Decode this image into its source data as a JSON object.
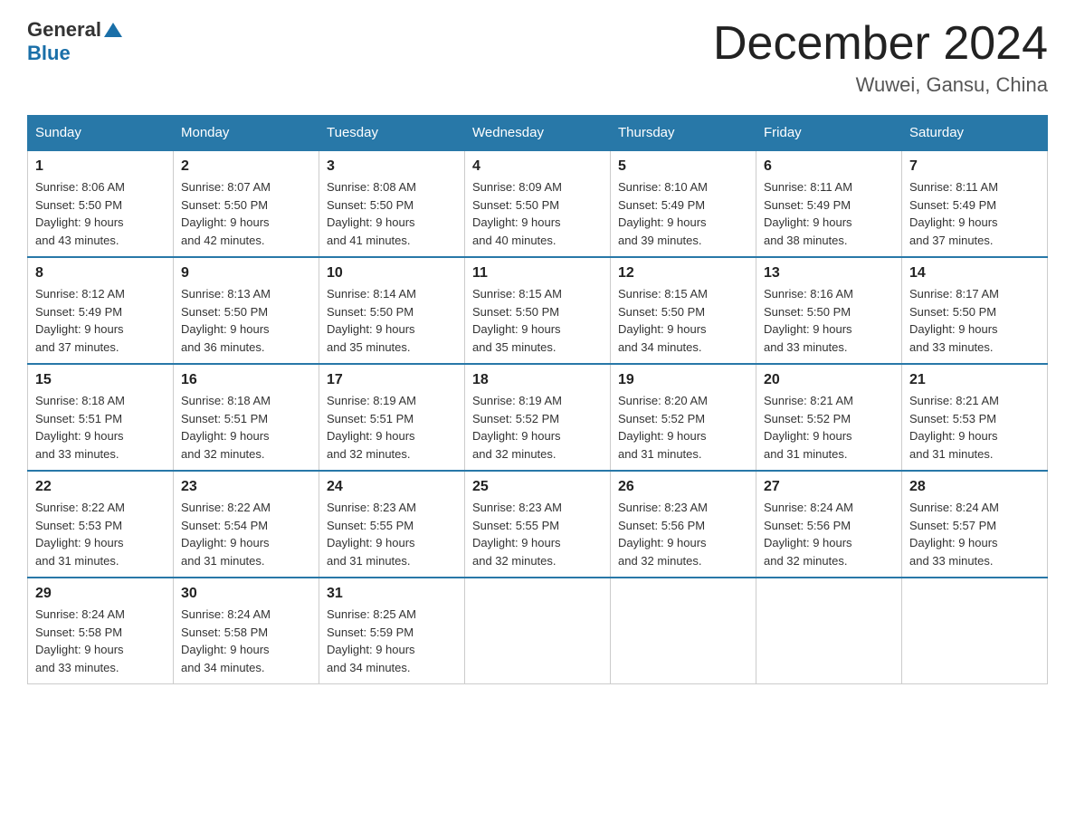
{
  "header": {
    "logo": {
      "general": "General",
      "blue": "Blue"
    },
    "title": "December 2024",
    "location": "Wuwei, Gansu, China"
  },
  "days_of_week": [
    "Sunday",
    "Monday",
    "Tuesday",
    "Wednesday",
    "Thursday",
    "Friday",
    "Saturday"
  ],
  "weeks": [
    [
      {
        "day": "1",
        "sunrise": "8:06 AM",
        "sunset": "5:50 PM",
        "daylight": "9 hours and 43 minutes."
      },
      {
        "day": "2",
        "sunrise": "8:07 AM",
        "sunset": "5:50 PM",
        "daylight": "9 hours and 42 minutes."
      },
      {
        "day": "3",
        "sunrise": "8:08 AM",
        "sunset": "5:50 PM",
        "daylight": "9 hours and 41 minutes."
      },
      {
        "day": "4",
        "sunrise": "8:09 AM",
        "sunset": "5:50 PM",
        "daylight": "9 hours and 40 minutes."
      },
      {
        "day": "5",
        "sunrise": "8:10 AM",
        "sunset": "5:49 PM",
        "daylight": "9 hours and 39 minutes."
      },
      {
        "day": "6",
        "sunrise": "8:11 AM",
        "sunset": "5:49 PM",
        "daylight": "9 hours and 38 minutes."
      },
      {
        "day": "7",
        "sunrise": "8:11 AM",
        "sunset": "5:49 PM",
        "daylight": "9 hours and 37 minutes."
      }
    ],
    [
      {
        "day": "8",
        "sunrise": "8:12 AM",
        "sunset": "5:49 PM",
        "daylight": "9 hours and 37 minutes."
      },
      {
        "day": "9",
        "sunrise": "8:13 AM",
        "sunset": "5:50 PM",
        "daylight": "9 hours and 36 minutes."
      },
      {
        "day": "10",
        "sunrise": "8:14 AM",
        "sunset": "5:50 PM",
        "daylight": "9 hours and 35 minutes."
      },
      {
        "day": "11",
        "sunrise": "8:15 AM",
        "sunset": "5:50 PM",
        "daylight": "9 hours and 35 minutes."
      },
      {
        "day": "12",
        "sunrise": "8:15 AM",
        "sunset": "5:50 PM",
        "daylight": "9 hours and 34 minutes."
      },
      {
        "day": "13",
        "sunrise": "8:16 AM",
        "sunset": "5:50 PM",
        "daylight": "9 hours and 33 minutes."
      },
      {
        "day": "14",
        "sunrise": "8:17 AM",
        "sunset": "5:50 PM",
        "daylight": "9 hours and 33 minutes."
      }
    ],
    [
      {
        "day": "15",
        "sunrise": "8:18 AM",
        "sunset": "5:51 PM",
        "daylight": "9 hours and 33 minutes."
      },
      {
        "day": "16",
        "sunrise": "8:18 AM",
        "sunset": "5:51 PM",
        "daylight": "9 hours and 32 minutes."
      },
      {
        "day": "17",
        "sunrise": "8:19 AM",
        "sunset": "5:51 PM",
        "daylight": "9 hours and 32 minutes."
      },
      {
        "day": "18",
        "sunrise": "8:19 AM",
        "sunset": "5:52 PM",
        "daylight": "9 hours and 32 minutes."
      },
      {
        "day": "19",
        "sunrise": "8:20 AM",
        "sunset": "5:52 PM",
        "daylight": "9 hours and 31 minutes."
      },
      {
        "day": "20",
        "sunrise": "8:21 AM",
        "sunset": "5:52 PM",
        "daylight": "9 hours and 31 minutes."
      },
      {
        "day": "21",
        "sunrise": "8:21 AM",
        "sunset": "5:53 PM",
        "daylight": "9 hours and 31 minutes."
      }
    ],
    [
      {
        "day": "22",
        "sunrise": "8:22 AM",
        "sunset": "5:53 PM",
        "daylight": "9 hours and 31 minutes."
      },
      {
        "day": "23",
        "sunrise": "8:22 AM",
        "sunset": "5:54 PM",
        "daylight": "9 hours and 31 minutes."
      },
      {
        "day": "24",
        "sunrise": "8:23 AM",
        "sunset": "5:55 PM",
        "daylight": "9 hours and 31 minutes."
      },
      {
        "day": "25",
        "sunrise": "8:23 AM",
        "sunset": "5:55 PM",
        "daylight": "9 hours and 32 minutes."
      },
      {
        "day": "26",
        "sunrise": "8:23 AM",
        "sunset": "5:56 PM",
        "daylight": "9 hours and 32 minutes."
      },
      {
        "day": "27",
        "sunrise": "8:24 AM",
        "sunset": "5:56 PM",
        "daylight": "9 hours and 32 minutes."
      },
      {
        "day": "28",
        "sunrise": "8:24 AM",
        "sunset": "5:57 PM",
        "daylight": "9 hours and 33 minutes."
      }
    ],
    [
      {
        "day": "29",
        "sunrise": "8:24 AM",
        "sunset": "5:58 PM",
        "daylight": "9 hours and 33 minutes."
      },
      {
        "day": "30",
        "sunrise": "8:24 AM",
        "sunset": "5:58 PM",
        "daylight": "9 hours and 34 minutes."
      },
      {
        "day": "31",
        "sunrise": "8:25 AM",
        "sunset": "5:59 PM",
        "daylight": "9 hours and 34 minutes."
      },
      null,
      null,
      null,
      null
    ]
  ],
  "labels": {
    "sunrise": "Sunrise:",
    "sunset": "Sunset:",
    "daylight": "Daylight:"
  }
}
